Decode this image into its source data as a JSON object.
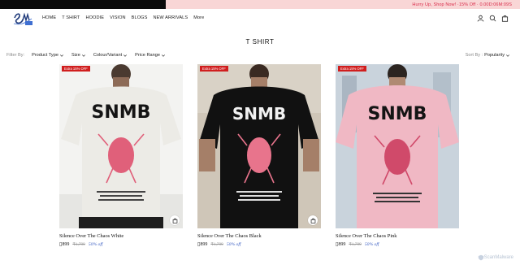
{
  "promo": {
    "text": "Hurry Up, Shop Now! ·15% Off · 0.00D:06M:09S"
  },
  "nav": [
    "HOME",
    "T SHIRT",
    "HOODIE",
    "VISION",
    "BLOGS",
    "NEW ARRIVALS",
    "More"
  ],
  "header_icons": [
    "user-icon",
    "search-icon",
    "bag-icon"
  ],
  "page_title": "T SHIRT",
  "filters": {
    "label": "Filter By:",
    "items": [
      "Product Type",
      "Size",
      "Colour/Variant",
      "Price Range"
    ]
  },
  "sort": {
    "label": "Sort By :",
    "value": "Popularity"
  },
  "products": [
    {
      "badge": "Extra 15% OFF",
      "name": "Silence Over The Chaos White",
      "price": "899",
      "mrp": "₹1,799",
      "off": "50% off",
      "shirt_color": "#ecebe6"
    },
    {
      "badge": "Extra 15% OFF",
      "name": "Silence Over The Chaos Black",
      "price": "899",
      "mrp": "₹1,799",
      "off": "50% off",
      "shirt_color": "#111111"
    },
    {
      "badge": "Extra 15% OFF",
      "name": "Silence Over The Chaos Pink",
      "price": "899",
      "mrp": "₹1,799",
      "off": "50% off",
      "shirt_color": "#f0b8c4"
    }
  ],
  "watermark": "ScanMalware",
  "colors": {
    "accent_red": "#d01e1e",
    "link_blue": "#3a5ec2",
    "promo_bg": "#f9d6d6"
  }
}
